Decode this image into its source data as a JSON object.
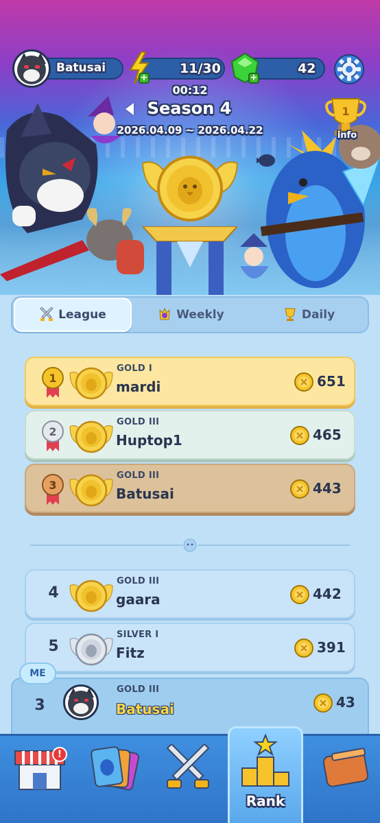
{
  "header": {
    "player_name": "Batusai",
    "energy": "11/30",
    "gems": "42",
    "timer": "00:12",
    "season_title": "Season 4",
    "season_dates": "2026.04.09 ~ 2026.04.22",
    "info_label": "info",
    "trophy_rank": "1"
  },
  "tabs": [
    {
      "label": "League",
      "icon": "crossed-swords-icon",
      "active": true
    },
    {
      "label": "Weekly",
      "icon": "weekly-badge-icon",
      "active": false
    },
    {
      "label": "Daily",
      "icon": "trophy-icon",
      "active": false
    }
  ],
  "top_ranks": [
    {
      "rank": "1",
      "tier": "GOLD I",
      "name": "mardi",
      "score": "651",
      "style": "gold"
    },
    {
      "rank": "2",
      "tier": "GOLD III",
      "name": "Huptop1",
      "score": "465",
      "style": "silver"
    },
    {
      "rank": "3",
      "tier": "GOLD III",
      "name": "Batusai",
      "score": "443",
      "style": "bronze"
    }
  ],
  "other_ranks": [
    {
      "rank": "4",
      "tier": "GOLD III",
      "name": "gaara",
      "score": "442",
      "badge": "gold"
    },
    {
      "rank": "5",
      "tier": "SILVER I",
      "name": "Fitz",
      "score": "391",
      "badge": "silver"
    }
  ],
  "me": {
    "tag": "ME",
    "rank": "3",
    "tier": "GOLD III",
    "name": "Batusai",
    "score": "43"
  },
  "nav": [
    {
      "id": "shop",
      "label": "",
      "icon": "shop-icon",
      "badge": "!"
    },
    {
      "id": "cards",
      "label": "",
      "icon": "cards-icon"
    },
    {
      "id": "battle",
      "label": "",
      "icon": "crossed-swords-icon"
    },
    {
      "id": "rank",
      "label": "Rank",
      "icon": "podium-icon",
      "active": true
    },
    {
      "id": "inventory",
      "label": "",
      "icon": "wallet-icon"
    }
  ],
  "colors": {
    "gold_row": "#fde7a0",
    "silver_row": "#e3f1ec",
    "bronze_row": "#dcc19a",
    "nav_bg": "#3f8fe0",
    "accent_name": "#f5d64a"
  }
}
